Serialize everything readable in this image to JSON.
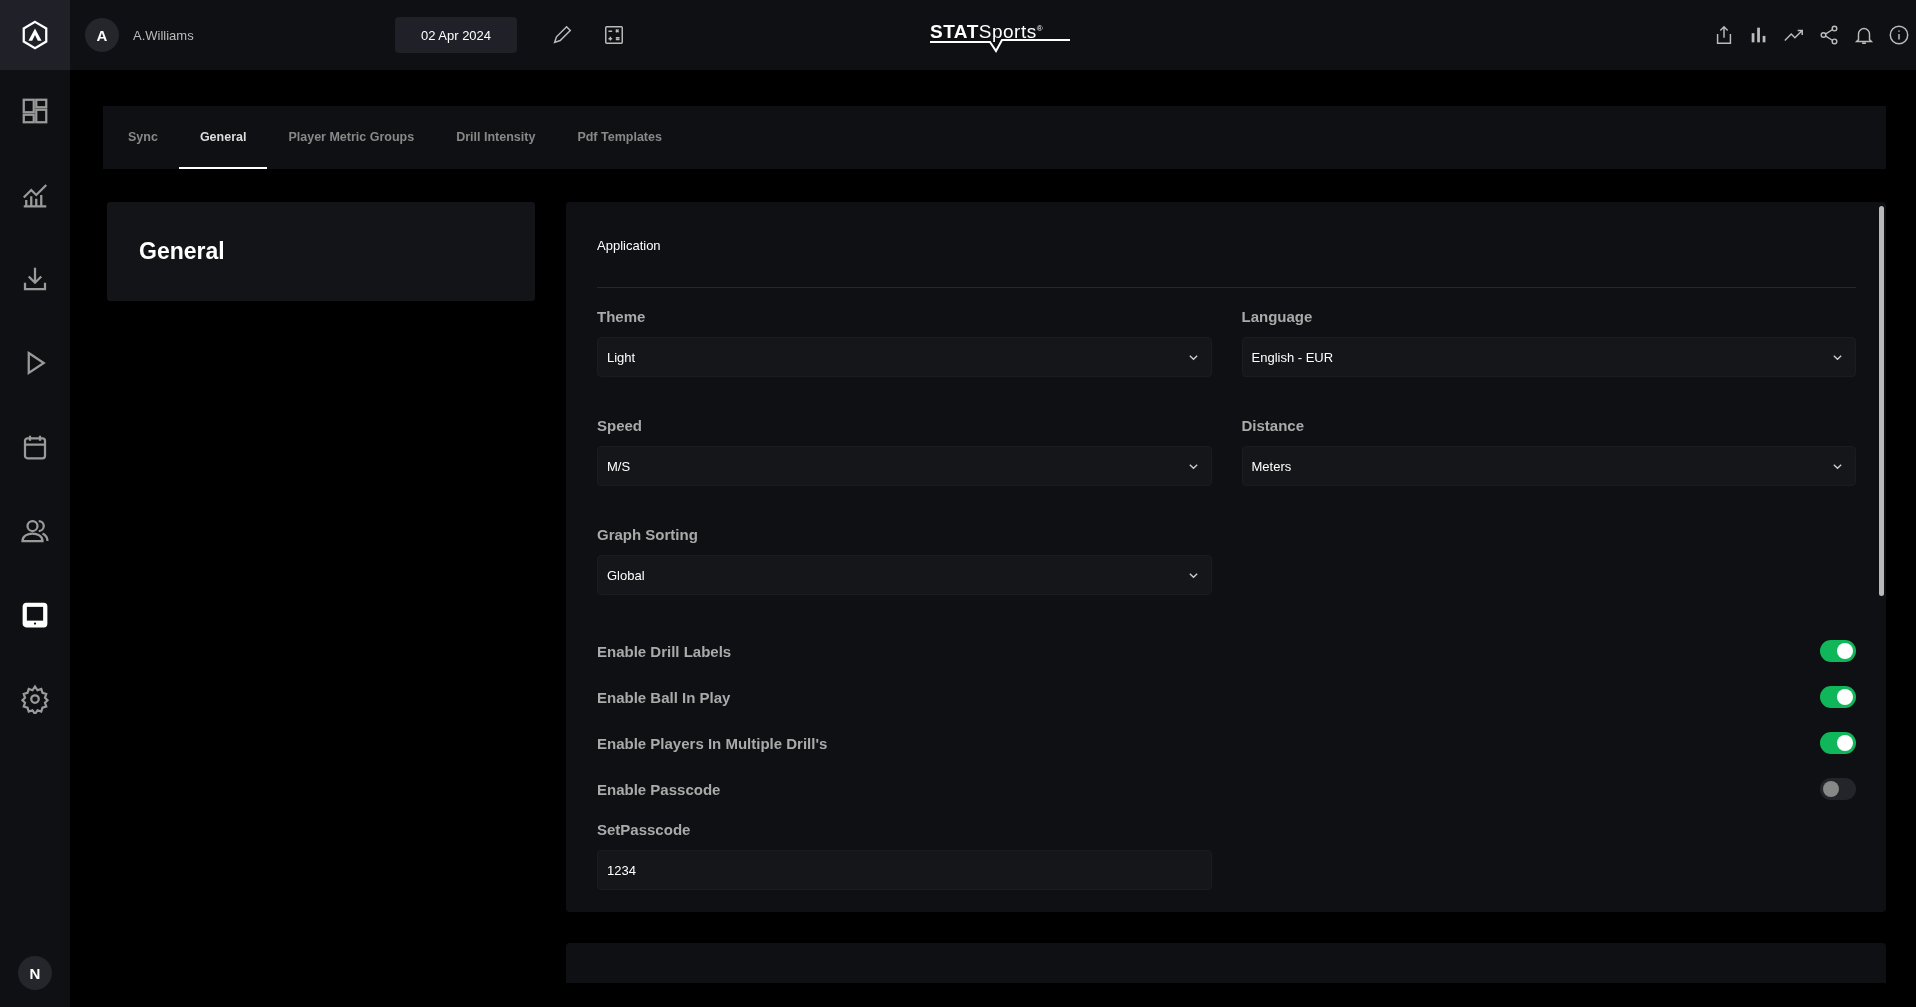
{
  "user": {
    "initial": "A",
    "name": "A.Williams"
  },
  "date": "02 Apr 2024",
  "brand": "**STAT**Sports$^{®}$",
  "sidebar": {
    "items": [
      {
        "kind": "dashboard",
        "selected": false
      },
      {
        "kind": "analysis",
        "selected": false
      },
      {
        "kind": "download",
        "selected": false
      },
      {
        "kind": "play",
        "selected": false
      },
      {
        "kind": "calendar",
        "selected": false
      },
      {
        "kind": "team",
        "selected": false
      },
      {
        "kind": "tablet",
        "selected": true
      },
      {
        "kind": "settings",
        "selected": false
      }
    ],
    "account_initial": "N"
  },
  "tabs": [
    {
      "label": "Sync",
      "selected": false
    },
    {
      "label": "General",
      "selected": true
    },
    {
      "label": "Player Metric Groups",
      "selected": false
    },
    {
      "label": "Drill Intensity",
      "selected": false
    },
    {
      "label": "Pdf Templates",
      "selected": false
    }
  ],
  "section_title": "General",
  "panel": {
    "heading": "Application",
    "fields": [
      {
        "kind": "select",
        "label": "Theme",
        "value": "Light"
      },
      {
        "kind": "select",
        "label": "Language",
        "value": "English - EUR"
      },
      {
        "kind": "select",
        "label": "Speed",
        "value": "M/S"
      },
      {
        "kind": "select",
        "label": "Distance",
        "value": "Meters"
      },
      {
        "kind": "select",
        "label": "Graph Sorting",
        "value": "Global"
      }
    ],
    "toggles": [
      {
        "label": "Enable Drill Labels",
        "on": true
      },
      {
        "label": "Enable Ball In Play",
        "on": true
      },
      {
        "label": "Enable Players In Multiple Drill's",
        "on": true
      },
      {
        "label": "Enable Passcode",
        "on": false
      }
    ],
    "passcode": {
      "label": "SetPasscode",
      "value": "1234"
    }
  }
}
